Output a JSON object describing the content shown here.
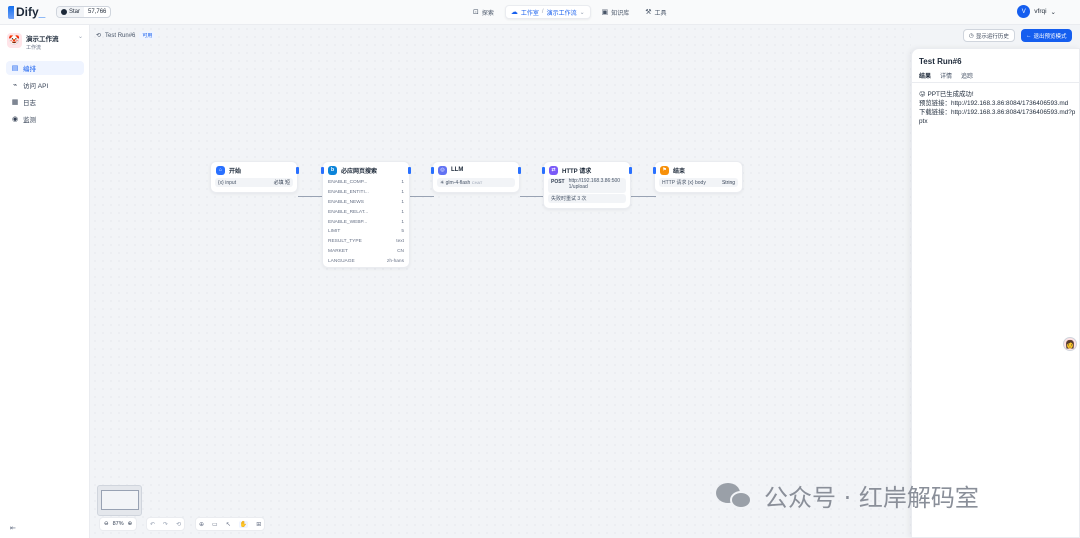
{
  "header": {
    "logo_text": "Dify",
    "github_label": "Star",
    "github_count": "57,766",
    "nav": [
      {
        "label": "探索"
      },
      {
        "label": "工作室"
      },
      {
        "label": "演示工作流"
      },
      {
        "label": "知识库"
      },
      {
        "label": "工具"
      }
    ],
    "user_initial": "V",
    "user_name": "vfrqi"
  },
  "sidebar": {
    "app_title": "演示工作流",
    "app_type": "工作流",
    "items": [
      {
        "label": "编排"
      },
      {
        "label": "访问 API"
      },
      {
        "label": "日志"
      },
      {
        "label": "监测"
      }
    ]
  },
  "canvas": {
    "run_label": "Test Run#6",
    "run_tag": "可用",
    "buttons": {
      "history": "显示运行历史",
      "exit": "退出预览模式"
    },
    "zoom": "87%"
  },
  "nodes": {
    "start": {
      "title": "开始",
      "var_name": "input",
      "var_type": "必填 短"
    },
    "search": {
      "title": "必应网页搜索",
      "params": [
        {
          "k": "ENABLE_COMP...",
          "v": "1"
        },
        {
          "k": "ENABLE_ENTITI...",
          "v": "1"
        },
        {
          "k": "ENABLE_NEWS",
          "v": "1"
        },
        {
          "k": "ENABLE_RELAT...",
          "v": "1"
        },
        {
          "k": "ENABLE_WEBP...",
          "v": "1"
        },
        {
          "k": "LIMIT",
          "v": "5"
        },
        {
          "k": "RESULT_TYPE",
          "v": "text"
        },
        {
          "k": "MARKET",
          "v": "CN"
        },
        {
          "k": "LANGUAGE",
          "v": "zh-hans"
        }
      ]
    },
    "llm": {
      "title": "LLM",
      "model": "glm-4-flash",
      "mode": "CHAT"
    },
    "http": {
      "title": "HTTP 请求",
      "method": "POST",
      "url": "http://192.168.3.86:5001/upload",
      "retry": "失败时重试 3 次"
    },
    "end": {
      "title": "结束",
      "var": "HTTP 请求 {x} body",
      "var_type": "String"
    }
  },
  "panel": {
    "title": "Test Run#6",
    "tabs": [
      {
        "label": "结果"
      },
      {
        "label": "详情"
      },
      {
        "label": "追踪"
      }
    ],
    "lines": [
      "😛 PPT已生成成功!",
      "预览链接：http://192.168.3.86:8084/1736406593.md",
      "下载链接：http://192.168.3.86:8084/1736406593.md?pptx"
    ]
  },
  "watermark": "公众号 · 红岸解码室",
  "colors": {
    "accent": "#155eef",
    "start": "#2970ff",
    "search": "#0b84d9",
    "llm": "#6172f3",
    "http": "#7a5af8",
    "end": "#f79009"
  }
}
